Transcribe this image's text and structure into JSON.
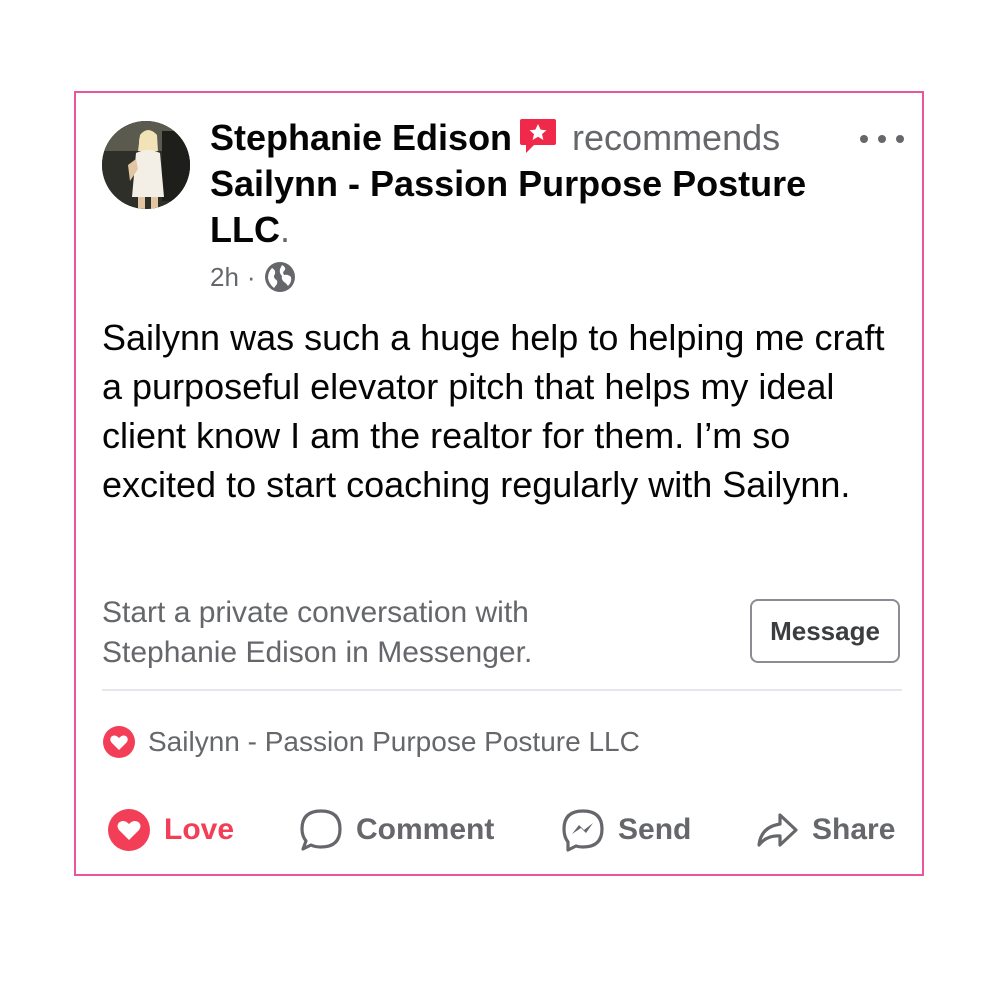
{
  "post": {
    "author": "Stephanie Edison",
    "verb": "recommends",
    "page": "Sailynn - Passion Purpose Posture LLC",
    "page_end": ".",
    "time": "2h",
    "time_sep": "·",
    "body": "Sailynn was such a huge help to helping me craft a purposeful elevator pitch that helps my ideal client know I am the realtor for them. I’m so excited to start coaching regularly with Sailynn.",
    "cta": "Start a private conversation with Stephanie Edison in Messenger.",
    "message_button": "Message",
    "reaction_names": "Sailynn - Passion Purpose Posture LLC"
  },
  "actions": {
    "love": "Love",
    "comment": "Comment",
    "send": "Send",
    "share": "Share"
  },
  "icons": {
    "recommend": "recommend-badge-icon",
    "more": "more-options-icon",
    "audience": "globe-icon",
    "reaction": "love-reaction-icon",
    "love": "love-icon",
    "comment": "comment-icon",
    "send": "messenger-icon",
    "share": "share-arrow-icon"
  },
  "colors": {
    "card_border": "#e8579c",
    "love": "#f33e58",
    "text_primary": "#050505",
    "text_secondary": "#65676b"
  }
}
